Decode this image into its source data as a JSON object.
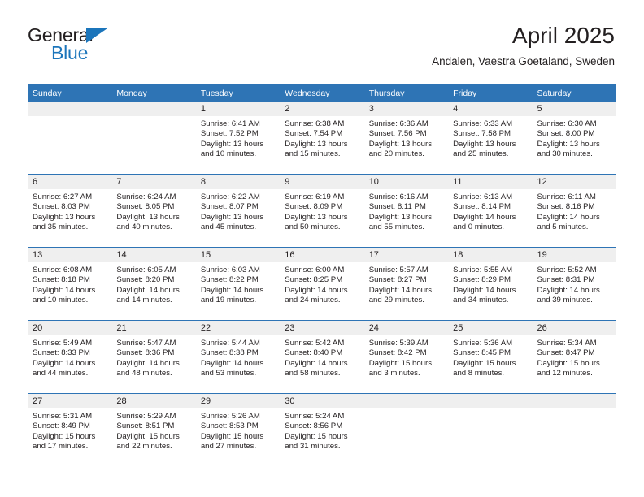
{
  "brand": {
    "name_part1": "General",
    "name_part2": "Blue",
    "accent_color": "#1b75bb"
  },
  "header": {
    "title": "April 2025",
    "subtitle": "Andalen, Vaestra Goetaland, Sweden"
  },
  "calendar": {
    "header_color": "#2e74b5",
    "daynum_band_color": "#efefef",
    "weekday_headers": [
      "Sunday",
      "Monday",
      "Tuesday",
      "Wednesday",
      "Thursday",
      "Friday",
      "Saturday"
    ],
    "weeks": [
      [
        {
          "day": "",
          "empty": true,
          "sunrise": "",
          "sunset": "",
          "daylight_line1": "",
          "daylight_line2": ""
        },
        {
          "day": "",
          "empty": true,
          "sunrise": "",
          "sunset": "",
          "daylight_line1": "",
          "daylight_line2": ""
        },
        {
          "day": "1",
          "empty": false,
          "sunrise": "Sunrise: 6:41 AM",
          "sunset": "Sunset: 7:52 PM",
          "daylight_line1": "Daylight: 13 hours",
          "daylight_line2": "and 10 minutes."
        },
        {
          "day": "2",
          "empty": false,
          "sunrise": "Sunrise: 6:38 AM",
          "sunset": "Sunset: 7:54 PM",
          "daylight_line1": "Daylight: 13 hours",
          "daylight_line2": "and 15 minutes."
        },
        {
          "day": "3",
          "empty": false,
          "sunrise": "Sunrise: 6:36 AM",
          "sunset": "Sunset: 7:56 PM",
          "daylight_line1": "Daylight: 13 hours",
          "daylight_line2": "and 20 minutes."
        },
        {
          "day": "4",
          "empty": false,
          "sunrise": "Sunrise: 6:33 AM",
          "sunset": "Sunset: 7:58 PM",
          "daylight_line1": "Daylight: 13 hours",
          "daylight_line2": "and 25 minutes."
        },
        {
          "day": "5",
          "empty": false,
          "sunrise": "Sunrise: 6:30 AM",
          "sunset": "Sunset: 8:00 PM",
          "daylight_line1": "Daylight: 13 hours",
          "daylight_line2": "and 30 minutes."
        }
      ],
      [
        {
          "day": "6",
          "empty": false,
          "sunrise": "Sunrise: 6:27 AM",
          "sunset": "Sunset: 8:03 PM",
          "daylight_line1": "Daylight: 13 hours",
          "daylight_line2": "and 35 minutes."
        },
        {
          "day": "7",
          "empty": false,
          "sunrise": "Sunrise: 6:24 AM",
          "sunset": "Sunset: 8:05 PM",
          "daylight_line1": "Daylight: 13 hours",
          "daylight_line2": "and 40 minutes."
        },
        {
          "day": "8",
          "empty": false,
          "sunrise": "Sunrise: 6:22 AM",
          "sunset": "Sunset: 8:07 PM",
          "daylight_line1": "Daylight: 13 hours",
          "daylight_line2": "and 45 minutes."
        },
        {
          "day": "9",
          "empty": false,
          "sunrise": "Sunrise: 6:19 AM",
          "sunset": "Sunset: 8:09 PM",
          "daylight_line1": "Daylight: 13 hours",
          "daylight_line2": "and 50 minutes."
        },
        {
          "day": "10",
          "empty": false,
          "sunrise": "Sunrise: 6:16 AM",
          "sunset": "Sunset: 8:11 PM",
          "daylight_line1": "Daylight: 13 hours",
          "daylight_line2": "and 55 minutes."
        },
        {
          "day": "11",
          "empty": false,
          "sunrise": "Sunrise: 6:13 AM",
          "sunset": "Sunset: 8:14 PM",
          "daylight_line1": "Daylight: 14 hours",
          "daylight_line2": "and 0 minutes."
        },
        {
          "day": "12",
          "empty": false,
          "sunrise": "Sunrise: 6:11 AM",
          "sunset": "Sunset: 8:16 PM",
          "daylight_line1": "Daylight: 14 hours",
          "daylight_line2": "and 5 minutes."
        }
      ],
      [
        {
          "day": "13",
          "empty": false,
          "sunrise": "Sunrise: 6:08 AM",
          "sunset": "Sunset: 8:18 PM",
          "daylight_line1": "Daylight: 14 hours",
          "daylight_line2": "and 10 minutes."
        },
        {
          "day": "14",
          "empty": false,
          "sunrise": "Sunrise: 6:05 AM",
          "sunset": "Sunset: 8:20 PM",
          "daylight_line1": "Daylight: 14 hours",
          "daylight_line2": "and 14 minutes."
        },
        {
          "day": "15",
          "empty": false,
          "sunrise": "Sunrise: 6:03 AM",
          "sunset": "Sunset: 8:22 PM",
          "daylight_line1": "Daylight: 14 hours",
          "daylight_line2": "and 19 minutes."
        },
        {
          "day": "16",
          "empty": false,
          "sunrise": "Sunrise: 6:00 AM",
          "sunset": "Sunset: 8:25 PM",
          "daylight_line1": "Daylight: 14 hours",
          "daylight_line2": "and 24 minutes."
        },
        {
          "day": "17",
          "empty": false,
          "sunrise": "Sunrise: 5:57 AM",
          "sunset": "Sunset: 8:27 PM",
          "daylight_line1": "Daylight: 14 hours",
          "daylight_line2": "and 29 minutes."
        },
        {
          "day": "18",
          "empty": false,
          "sunrise": "Sunrise: 5:55 AM",
          "sunset": "Sunset: 8:29 PM",
          "daylight_line1": "Daylight: 14 hours",
          "daylight_line2": "and 34 minutes."
        },
        {
          "day": "19",
          "empty": false,
          "sunrise": "Sunrise: 5:52 AM",
          "sunset": "Sunset: 8:31 PM",
          "daylight_line1": "Daylight: 14 hours",
          "daylight_line2": "and 39 minutes."
        }
      ],
      [
        {
          "day": "20",
          "empty": false,
          "sunrise": "Sunrise: 5:49 AM",
          "sunset": "Sunset: 8:33 PM",
          "daylight_line1": "Daylight: 14 hours",
          "daylight_line2": "and 44 minutes."
        },
        {
          "day": "21",
          "empty": false,
          "sunrise": "Sunrise: 5:47 AM",
          "sunset": "Sunset: 8:36 PM",
          "daylight_line1": "Daylight: 14 hours",
          "daylight_line2": "and 48 minutes."
        },
        {
          "day": "22",
          "empty": false,
          "sunrise": "Sunrise: 5:44 AM",
          "sunset": "Sunset: 8:38 PM",
          "daylight_line1": "Daylight: 14 hours",
          "daylight_line2": "and 53 minutes."
        },
        {
          "day": "23",
          "empty": false,
          "sunrise": "Sunrise: 5:42 AM",
          "sunset": "Sunset: 8:40 PM",
          "daylight_line1": "Daylight: 14 hours",
          "daylight_line2": "and 58 minutes."
        },
        {
          "day": "24",
          "empty": false,
          "sunrise": "Sunrise: 5:39 AM",
          "sunset": "Sunset: 8:42 PM",
          "daylight_line1": "Daylight: 15 hours",
          "daylight_line2": "and 3 minutes."
        },
        {
          "day": "25",
          "empty": false,
          "sunrise": "Sunrise: 5:36 AM",
          "sunset": "Sunset: 8:45 PM",
          "daylight_line1": "Daylight: 15 hours",
          "daylight_line2": "and 8 minutes."
        },
        {
          "day": "26",
          "empty": false,
          "sunrise": "Sunrise: 5:34 AM",
          "sunset": "Sunset: 8:47 PM",
          "daylight_line1": "Daylight: 15 hours",
          "daylight_line2": "and 12 minutes."
        }
      ],
      [
        {
          "day": "27",
          "empty": false,
          "sunrise": "Sunrise: 5:31 AM",
          "sunset": "Sunset: 8:49 PM",
          "daylight_line1": "Daylight: 15 hours",
          "daylight_line2": "and 17 minutes."
        },
        {
          "day": "28",
          "empty": false,
          "sunrise": "Sunrise: 5:29 AM",
          "sunset": "Sunset: 8:51 PM",
          "daylight_line1": "Daylight: 15 hours",
          "daylight_line2": "and 22 minutes."
        },
        {
          "day": "29",
          "empty": false,
          "sunrise": "Sunrise: 5:26 AM",
          "sunset": "Sunset: 8:53 PM",
          "daylight_line1": "Daylight: 15 hours",
          "daylight_line2": "and 27 minutes."
        },
        {
          "day": "30",
          "empty": false,
          "sunrise": "Sunrise: 5:24 AM",
          "sunset": "Sunset: 8:56 PM",
          "daylight_line1": "Daylight: 15 hours",
          "daylight_line2": "and 31 minutes."
        },
        {
          "day": "",
          "empty": true,
          "sunrise": "",
          "sunset": "",
          "daylight_line1": "",
          "daylight_line2": ""
        },
        {
          "day": "",
          "empty": true,
          "sunrise": "",
          "sunset": "",
          "daylight_line1": "",
          "daylight_line2": ""
        },
        {
          "day": "",
          "empty": true,
          "sunrise": "",
          "sunset": "",
          "daylight_line1": "",
          "daylight_line2": ""
        }
      ]
    ]
  }
}
